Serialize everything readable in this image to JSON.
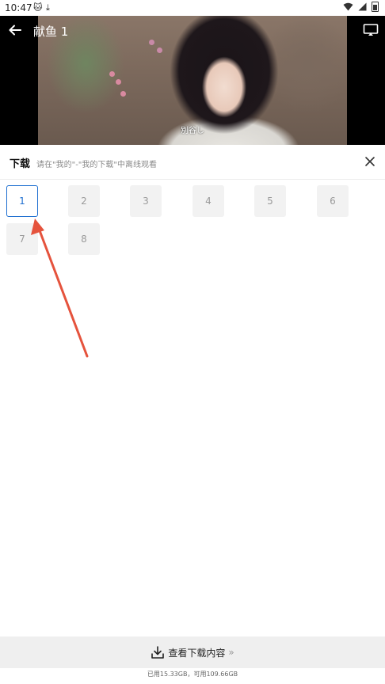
{
  "status_bar": {
    "time": "10:47"
  },
  "player": {
    "title": "献鱼 1",
    "subtitle_text": "別谷し"
  },
  "download_sheet": {
    "title": "下载",
    "hint": "请在\"我的\"-\"我的下载\"中离线观看",
    "episodes": [
      "1",
      "2",
      "3",
      "4",
      "5",
      "6",
      "7",
      "8"
    ],
    "selected_episode": "1"
  },
  "bottom": {
    "view_downloads_label": "查看下载内容",
    "chevron": "»",
    "storage_text": "已用15.33GB，可用109.66GB"
  },
  "colors": {
    "accent": "#1e6fd0",
    "annotation_arrow": "#e5533d"
  }
}
